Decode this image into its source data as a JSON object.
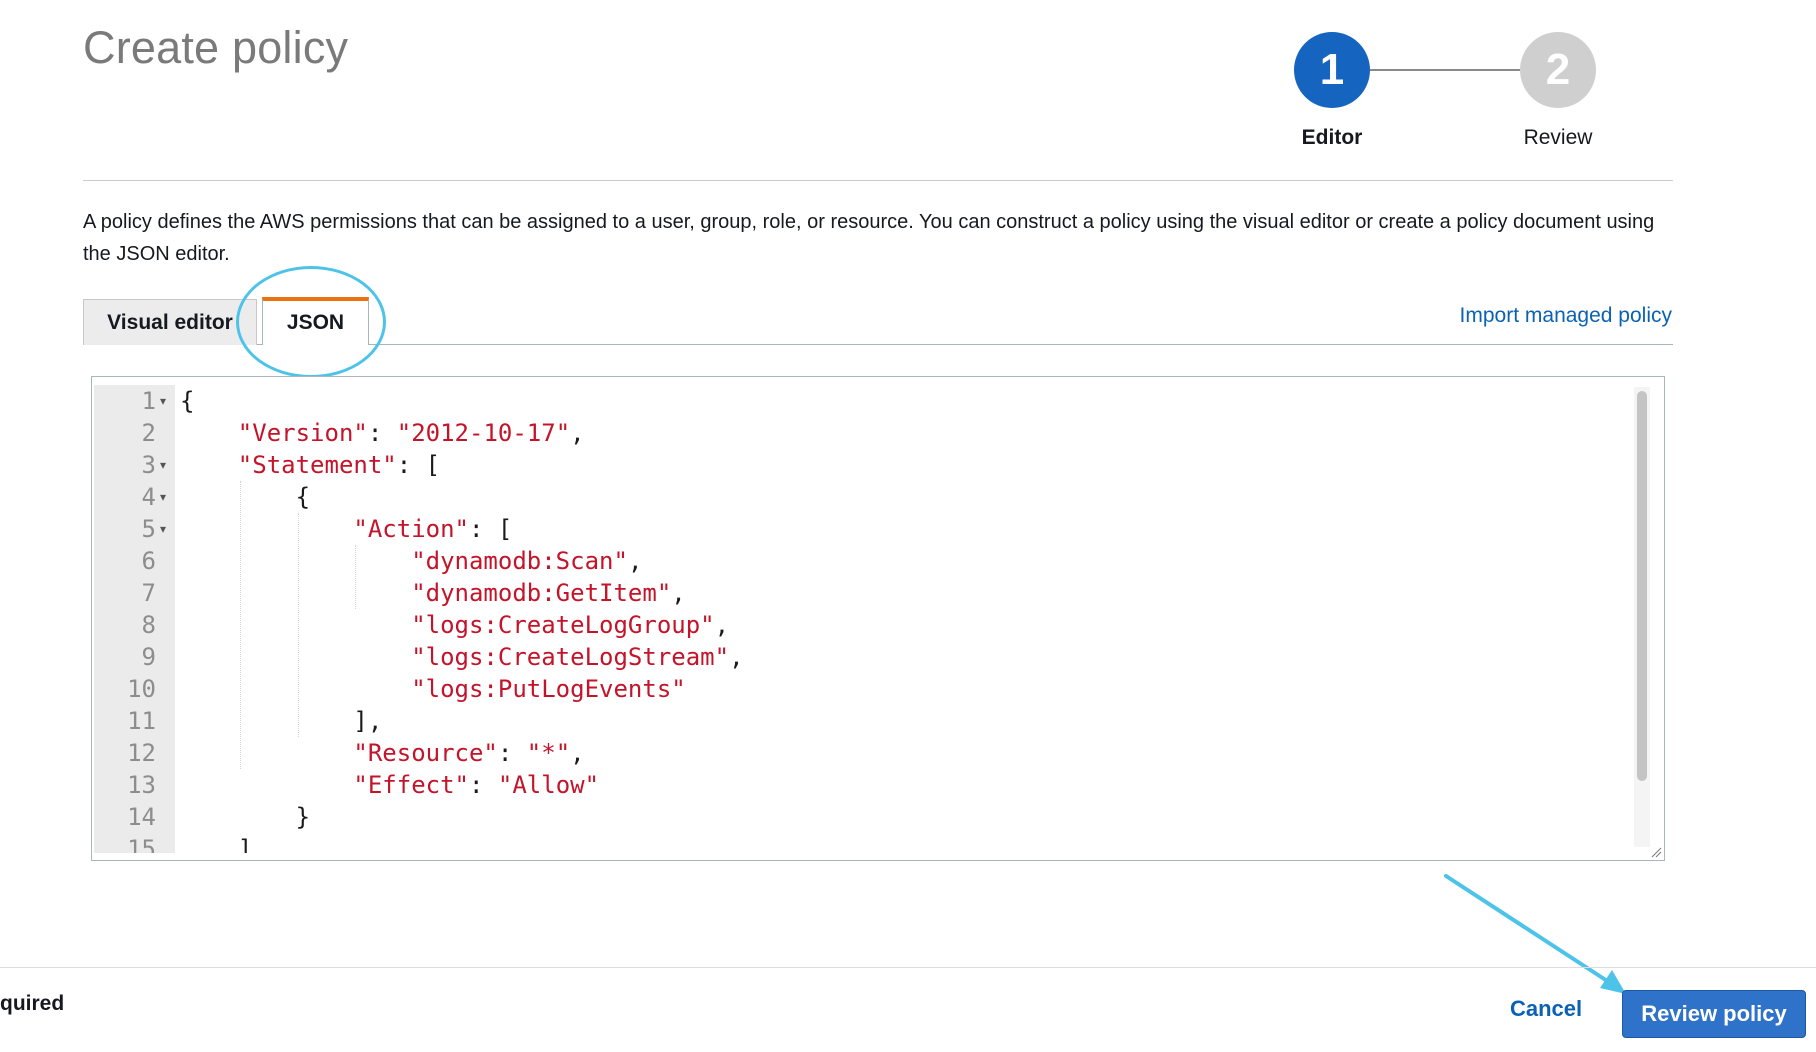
{
  "header": {
    "title": "Create policy",
    "steps": [
      {
        "number": "1",
        "label": "Editor",
        "active": true
      },
      {
        "number": "2",
        "label": "Review",
        "active": false
      }
    ]
  },
  "description": "A policy defines the AWS permissions that can be assigned to a user, group, role, or resource. You can construct a policy using the visual editor or create a policy document using the JSON editor.",
  "tabs": [
    {
      "label": "Visual editor",
      "active": false
    },
    {
      "label": "JSON",
      "active": true
    }
  ],
  "import_link": "Import managed policy",
  "editor": {
    "line_numbers": [
      "1",
      "2",
      "3",
      "4",
      "5",
      "6",
      "7",
      "8",
      "9",
      "10",
      "11",
      "12",
      "13",
      "14",
      "15"
    ],
    "lines": [
      "{",
      "    \"Version\": \"2012-10-17\",",
      "    \"Statement\": [",
      "        {",
      "            \"Action\": [",
      "                \"dynamodb:Scan\",",
      "                \"dynamodb:GetItem\",",
      "                \"logs:CreateLogGroup\",",
      "                \"logs:CreateLogStream\",",
      "                \"logs:PutLogEvents\"",
      "            ],",
      "            \"Resource\": \"*\",",
      "            \"Effect\": \"Allow\"",
      "        }",
      "    ]"
    ],
    "folds": [
      true,
      false,
      true,
      true,
      true,
      false,
      false,
      false,
      false,
      false,
      false,
      false,
      false,
      false,
      false
    ]
  },
  "footer": {
    "required_note": "quired",
    "cancel_label": "Cancel",
    "review_label": "Review policy"
  },
  "colors": {
    "primary": "#1565c0",
    "step_inactive": "#cfcfcf",
    "tab_accent": "#ec7211",
    "link": "#0b62b5",
    "string": "#c4142a",
    "annotation": "#4ec3e9",
    "button": "#2f72c9"
  }
}
